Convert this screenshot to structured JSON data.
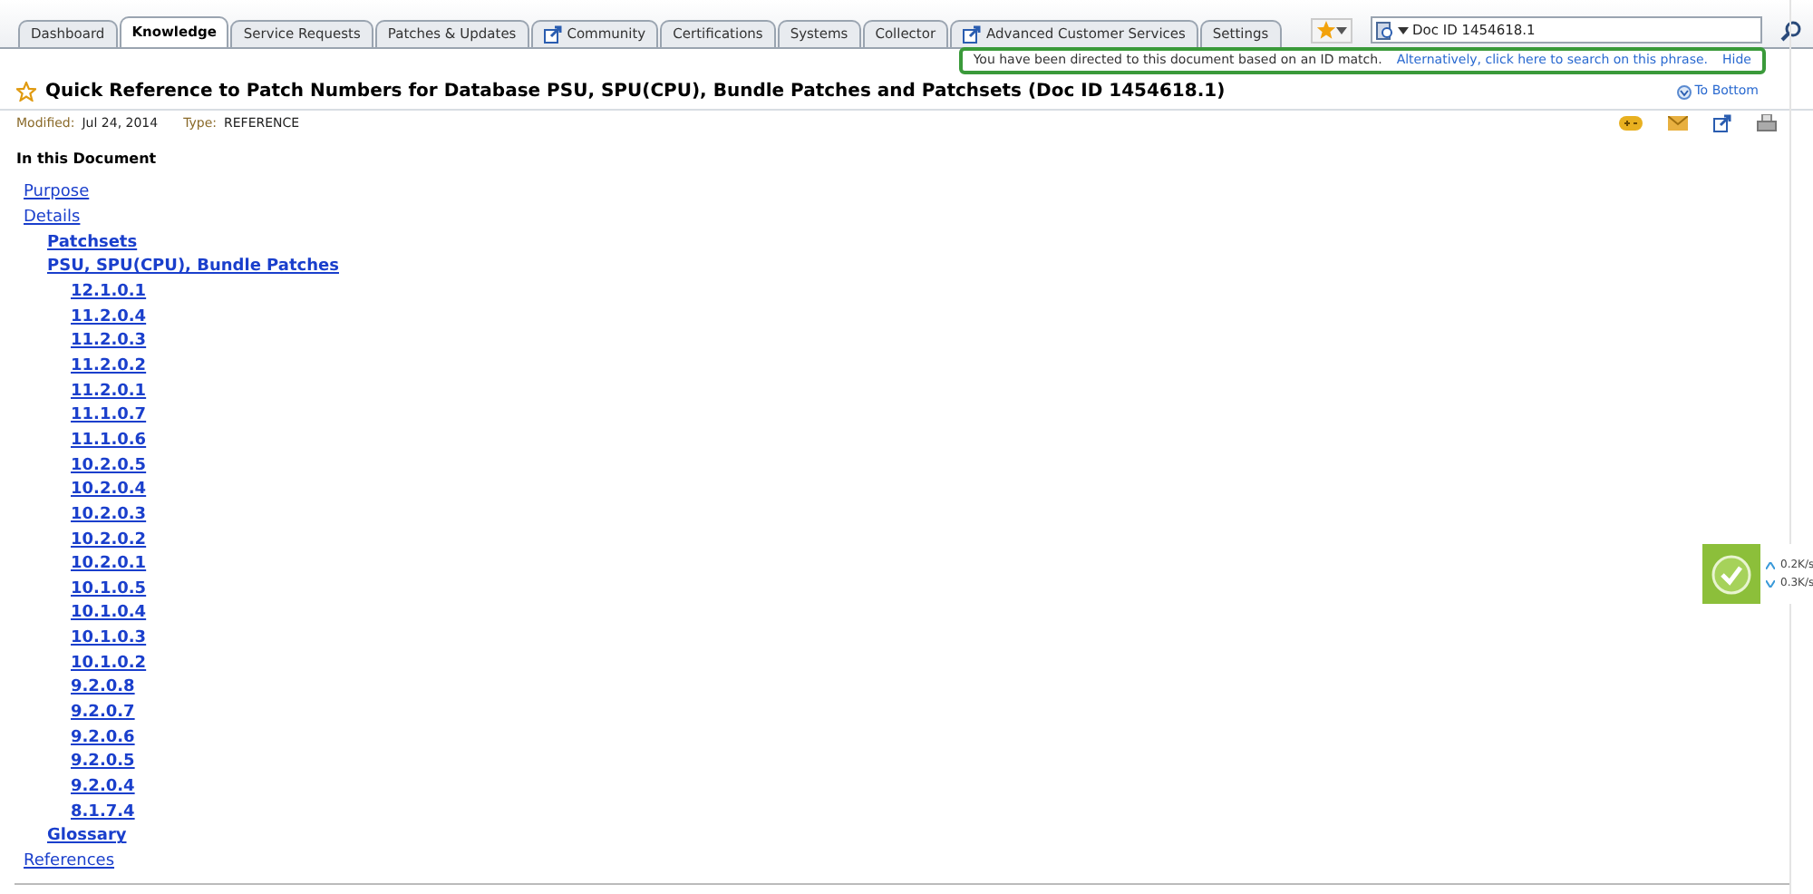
{
  "tabs": [
    {
      "label": "Dashboard",
      "selected": false,
      "external": false
    },
    {
      "label": "Knowledge",
      "selected": true,
      "external": false
    },
    {
      "label": "Service Requests",
      "selected": false,
      "external": false
    },
    {
      "label": "Patches & Updates",
      "selected": false,
      "external": false
    },
    {
      "label": "Community",
      "selected": false,
      "external": true
    },
    {
      "label": "Certifications",
      "selected": false,
      "external": false
    },
    {
      "label": "Systems",
      "selected": false,
      "external": false
    },
    {
      "label": "Collector",
      "selected": false,
      "external": false
    },
    {
      "label": "Advanced Customer Services",
      "selected": false,
      "external": true
    },
    {
      "label": "Settings",
      "selected": false,
      "external": false
    }
  ],
  "search": {
    "value": "Doc ID 1454618.1"
  },
  "notice": {
    "text": "You have been directed to this document based on an ID match.",
    "link": "Alternatively, click here to search on this phrase.",
    "hide": "Hide"
  },
  "document": {
    "title": "Quick Reference to Patch Numbers for Database PSU, SPU(CPU), Bundle Patches and Patchsets (Doc ID 1454618.1)",
    "to_bottom": "To Bottom",
    "meta": [
      {
        "label": "Modified:",
        "value": "Jul 24, 2014"
      },
      {
        "label": "Type:",
        "value": "REFERENCE"
      }
    ],
    "toc_heading": "In this Document",
    "toc": [
      {
        "label": "Purpose"
      },
      {
        "label": "Details",
        "children": [
          {
            "label": "Patchsets"
          },
          {
            "label": "PSU, SPU(CPU), Bundle Patches",
            "children": [
              {
                "label": "12.1.0.1"
              },
              {
                "label": "11.2.0.4"
              },
              {
                "label": "11.2.0.3"
              },
              {
                "label": "11.2.0.2"
              },
              {
                "label": "11.2.0.1"
              },
              {
                "label": "11.1.0.7"
              },
              {
                "label": "11.1.0.6"
              },
              {
                "label": "10.2.0.5"
              },
              {
                "label": "10.2.0.4"
              },
              {
                "label": "10.2.0.3"
              },
              {
                "label": "10.2.0.2"
              },
              {
                "label": "10.2.0.1"
              },
              {
                "label": "10.1.0.5"
              },
              {
                "label": "10.1.0.4"
              },
              {
                "label": "10.1.0.3"
              },
              {
                "label": "10.1.0.2"
              },
              {
                "label": "9.2.0.8"
              },
              {
                "label": "9.2.0.7"
              },
              {
                "label": "9.2.0.6"
              },
              {
                "label": "9.2.0.5"
              },
              {
                "label": "9.2.0.4"
              },
              {
                "label": "8.1.7.4"
              }
            ]
          },
          {
            "label": "Glossary"
          }
        ]
      },
      {
        "label": "References"
      }
    ]
  },
  "net_widget": {
    "up": "0.2K/s",
    "down": "0.3K/s"
  }
}
